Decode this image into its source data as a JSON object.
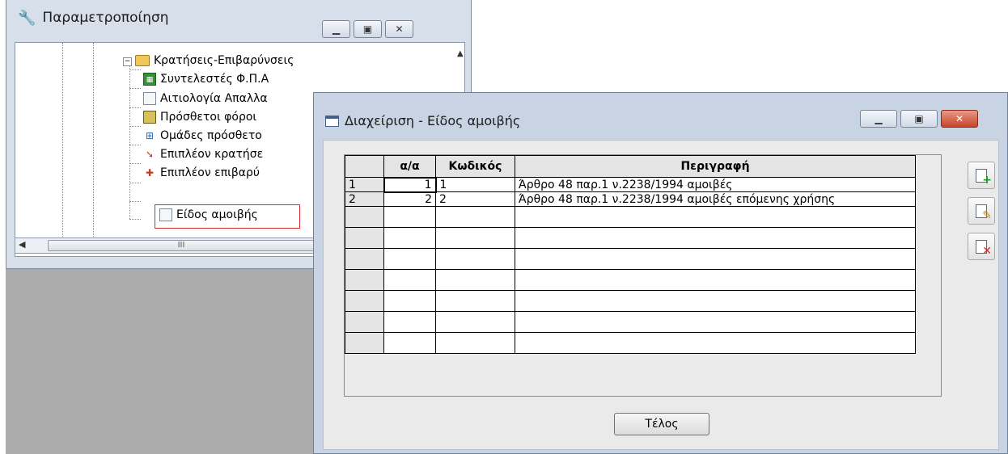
{
  "tree_window": {
    "title": "Παραμετροποίηση",
    "parent_node": "Κρατήσεις-Επιβαρύνσεις",
    "items": [
      {
        "label": "Συντελεστές Φ.Π.Α",
        "icon": "vat-rates-icon"
      },
      {
        "label": "Αιτιολογία Απαλλα",
        "icon": "exemption-reason-icon"
      },
      {
        "label": "Πρόσθετοι φόροι",
        "icon": "calculator-icon"
      },
      {
        "label": "Ομάδες πρόσθετο",
        "icon": "group-icon"
      },
      {
        "label": "Επιπλέον κρατήσε",
        "icon": "deduction-icon"
      },
      {
        "label": "Επιπλέον επιβαρύ",
        "icon": "charge-icon"
      },
      {
        "label": "Είδος αμοιβής",
        "icon": "document-icon"
      }
    ],
    "scroll_thumb": "III"
  },
  "dialog": {
    "title": "Διαχείριση - Είδος αμοιβής",
    "columns": [
      "",
      "α/α",
      "Κωδικός",
      "Περιγραφή"
    ],
    "rows": [
      {
        "row_header": "1",
        "aa": "1",
        "code": "1",
        "description": "Άρθρο 48 παρ.1 ν.2238/1994 αμοιβές"
      },
      {
        "row_header": "2",
        "aa": "2",
        "code": "2",
        "description": "Άρθρο 48 παρ.1 ν.2238/1994 αμοιβές επόμενης χρήσης"
      }
    ],
    "empty_rows": 7,
    "ok_button": "Τέλος"
  },
  "colors": {
    "workspace": "#ababab",
    "dialog_frame": "#c8d4e4",
    "selection_border": "#d42a2a",
    "close_button": "#c7442b"
  }
}
